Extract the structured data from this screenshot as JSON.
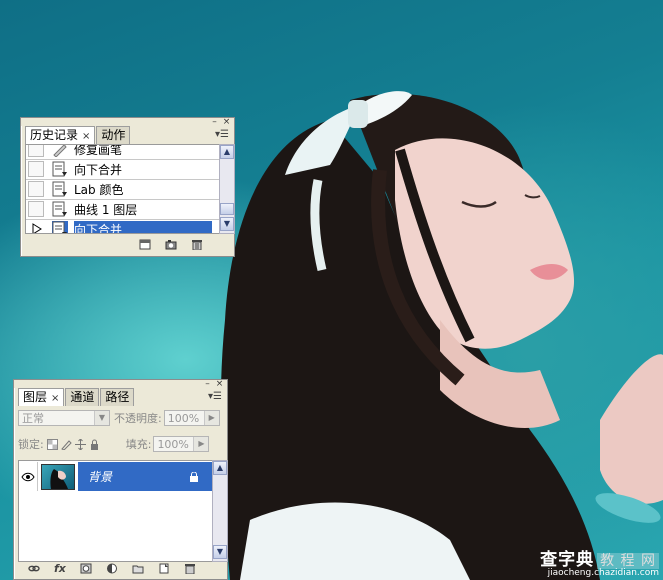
{
  "history_panel": {
    "tabs": [
      {
        "label": "历史记录",
        "active": true
      },
      {
        "label": "动作",
        "active": false
      }
    ],
    "items": [
      {
        "label": "修复画笔",
        "icon": "healing-brush-icon"
      },
      {
        "label": "向下合并",
        "icon": "history-state-icon"
      },
      {
        "label": "Lab 颜色",
        "icon": "history-state-icon"
      },
      {
        "label": "曲线 1 图层",
        "icon": "history-state-icon"
      },
      {
        "label": "向下合并",
        "icon": "history-state-icon",
        "selected": true
      }
    ],
    "bottom_icons": [
      "new-document-from-state-icon",
      "new-snapshot-icon",
      "delete-icon"
    ]
  },
  "layers_panel": {
    "tabs": [
      {
        "label": "图层",
        "active": true
      },
      {
        "label": "通道",
        "active": false
      },
      {
        "label": "路径",
        "active": false
      }
    ],
    "blend_mode": "正常",
    "opacity_label": "不透明度:",
    "opacity_value": "100%",
    "lock_label": "锁定:",
    "fill_label": "填充:",
    "fill_value": "100%",
    "layers": [
      {
        "name": "背景",
        "visible": true,
        "locked": true,
        "selected": true
      }
    ],
    "bottom_icons": [
      "link-icon",
      "fx-icon",
      "mask-icon",
      "adjustment-icon",
      "group-icon",
      "new-layer-icon",
      "trash-icon"
    ],
    "fx_label": "fx"
  },
  "watermark": {
    "line1": "查字典",
    "line1_tail": "教 程 网",
    "line2": "jiaocheng.chazidian.com"
  },
  "colors": {
    "selection": "#316ac5",
    "panel_bg": "#ece9d8"
  }
}
